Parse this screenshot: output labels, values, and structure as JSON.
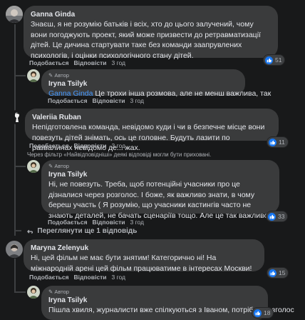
{
  "comments": [
    {
      "name": "Ganna Ginda",
      "text": "Знаєш, я не розумію батьків і всіх, хто до цього залучений, чому вони погоджують проект, який може призвести до ретравматизації дітей. Це дичина стартувати таке без команди заапрувлених психологів, і оцінки психологічного стану дітей.",
      "like_label": "Подобається",
      "reply_label": "Відповісти",
      "time": "3 год",
      "reactions": "51"
    },
    {
      "name": "Iryna Tsilyk",
      "badge": "Автор",
      "mention": "Ganna Ginda",
      "text": " Це трохи інша розмова, але не менш важлива, так",
      "like_label": "Подобається",
      "reply_label": "Відповісти",
      "time": "3 год"
    },
    {
      "name": "Valeriia Ruban",
      "text": "Непідготовлена команда, невідомо куди і чи в безпечне місце вони повезуть дітей знімать, ось це головне. Будуть лазити по развалинах невідомо де... жах.",
      "like_label": "Подобається",
      "reply_label": "Відповісти",
      "time": "3 год",
      "reactions": "11"
    },
    {
      "name": "Iryna Tsilyk",
      "badge": "Автор",
      "text": "Ні, не повезуть. Треба, щоб потенційні учасники про це дізналися через розголос. І боже, як важливо знати, в чому береш участь ( Я розумію, що учасники кастингів часто не знають деталей, не бачать сценаріїв тощо. Але це так важливо",
      "like_label": "Подобається",
      "reply_label": "Відповісти",
      "time": "3 год",
      "reactions": "33"
    },
    {
      "name": "Maryna Zelenyuk",
      "text": "Ні, цей фільм не має бути знятим! Категорично ні! На міжнародній арені цей фільм працюватиме в інтересах Москви!",
      "like_label": "Подобається",
      "reply_label": "Відповісти",
      "time": "3 год",
      "reactions": "15"
    },
    {
      "name": "Iryna Tsilyk",
      "badge": "Автор",
      "text": "Пішла хвиля, журналисти вже спілкуються з Іваном, потрібен розголос",
      "reactions": "18"
    }
  ],
  "filter_notice": "Через фільтр «Найвідповідніші» деякі відповіді могли бути приховані.",
  "more_replies": "Переглянути ще 1 відповідь",
  "colors": {
    "bubble": "#3a3b3c",
    "background": "#18191a",
    "link": "#4599ff",
    "like": "#1877f2"
  },
  "icons": [
    "like-icon",
    "pencil-icon",
    "reply-arrow-icon",
    "avatar"
  ]
}
